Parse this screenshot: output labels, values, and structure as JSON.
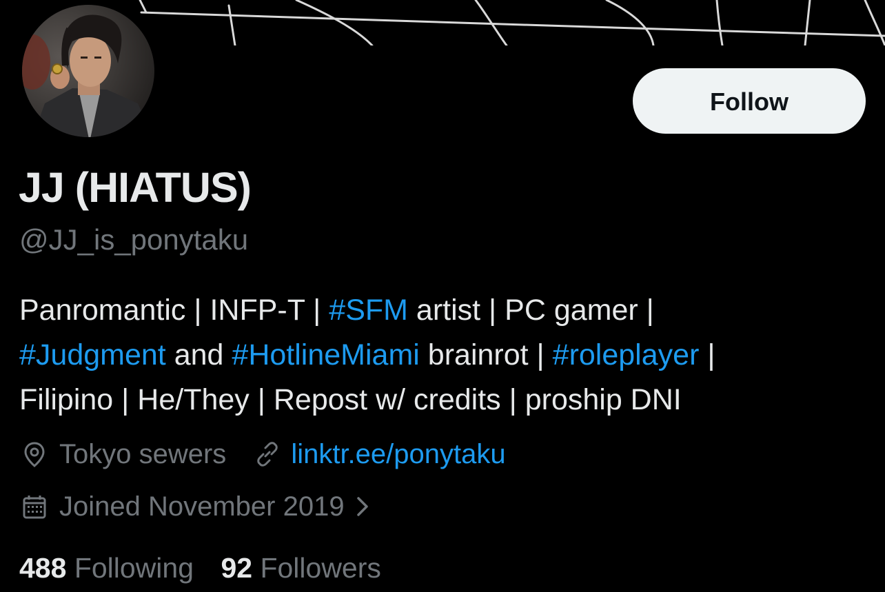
{
  "profile": {
    "display_name": "JJ (HIATUS)",
    "handle": "@JJ_is_ponytaku",
    "follow_label": "Follow",
    "bio": {
      "line1": [
        {
          "t": "Panromantic | INFP-T | ",
          "tag": false
        },
        {
          "t": "#SFM",
          "tag": true
        },
        {
          "t": " artist | PC gamer |",
          "tag": false
        }
      ],
      "line2": [
        {
          "t": "#Judgment",
          "tag": true
        },
        {
          "t": " and ",
          "tag": false
        },
        {
          "t": "#HotlineMiami",
          "tag": true
        },
        {
          "t": " brainrot | ",
          "tag": false
        },
        {
          "t": "#roleplayer",
          "tag": true
        },
        {
          "t": " |",
          "tag": false
        }
      ],
      "line3": [
        {
          "t": "Filipino | He/They | Repost w/ credits | proship DNI",
          "tag": false
        }
      ]
    },
    "location": "Tokyo sewers",
    "website": "linktr.ee/ponytaku",
    "joined": "Joined November 2019",
    "following_count": "488",
    "following_label": "Following",
    "followers_count": "92",
    "followers_label": "Followers"
  },
  "icons": {
    "location": "location-pin-icon",
    "link": "link-icon",
    "calendar": "calendar-icon",
    "chevron": "chevron-right-icon"
  },
  "colors": {
    "background": "#000000",
    "text": "#e7e9ea",
    "secondary": "#71767b",
    "accent": "#1d9bf0",
    "button_bg": "#eff3f4"
  }
}
